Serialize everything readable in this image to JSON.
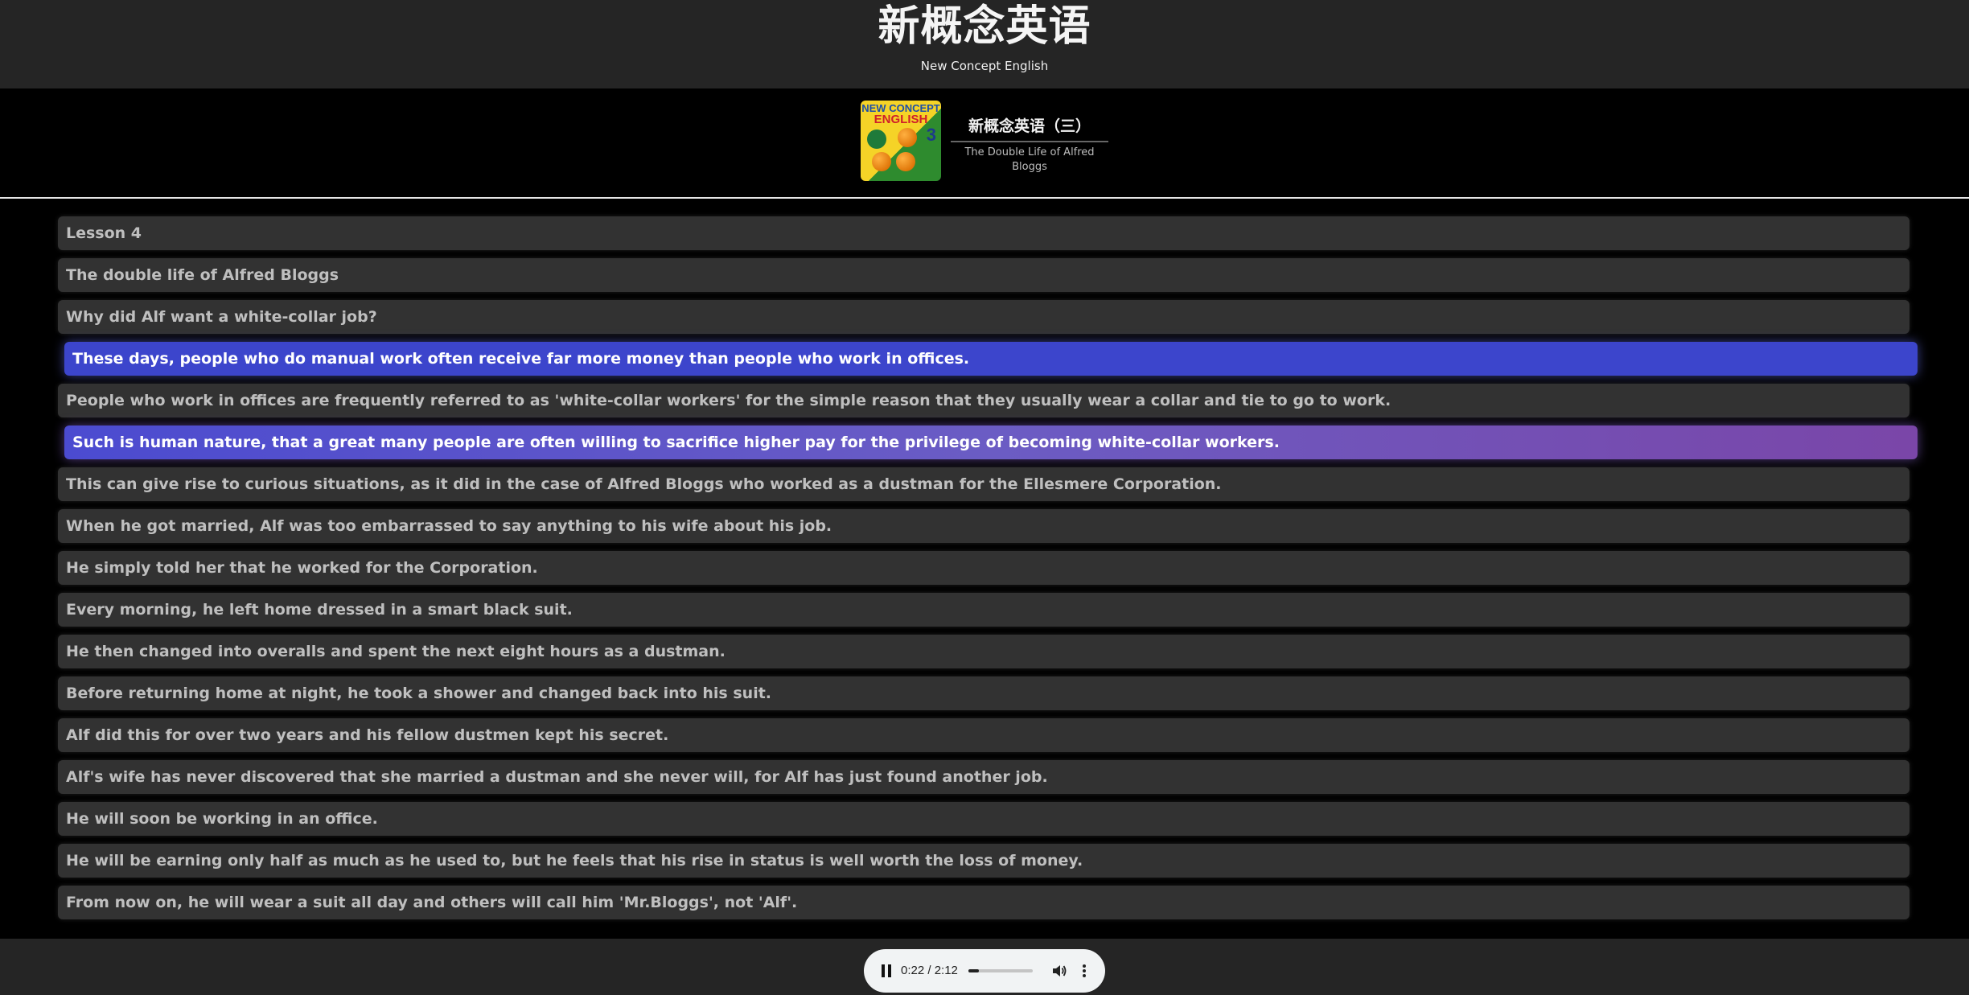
{
  "header": {
    "title": "新概念英语",
    "subtitle": "New Concept English"
  },
  "book": {
    "cover": {
      "line1": "NEW CONCEPT",
      "line2": "ENGLISH",
      "number": "3"
    },
    "name": "新概念英语（三）",
    "lesson_title": "The Double Life of Alfred Bloggs"
  },
  "sentences": [
    "Lesson 4",
    "The double life of Alfred Bloggs",
    "Why did Alf want a white-collar job?",
    "These days, people who do manual work often receive far more money than people who work in offices.",
    "People who work in offices are frequently referred to as 'white-collar workers' for the simple reason that they usually wear a collar and tie to go to work.",
    "Such is human nature, that a great many people are often willing to sacrifice higher pay for the privilege of becoming white-collar workers.",
    "This can give rise to curious situations, as it did in the case of Alfred Bloggs who worked as a dustman for the Ellesmere Corporation.",
    "When he got married, Alf was too embarrassed to say anything to his wife about his job.",
    "He simply told her that he worked for the Corporation.",
    "Every morning, he left home dressed in a smart black suit.",
    "He then changed into overalls and spent the next eight hours as a dustman.",
    "Before returning home at night, he took a shower and changed back into his suit.",
    "Alf did this for over two years and his fellow dustmen kept his secret.",
    "Alf's wife has never discovered that she married a dustman and she never will, for Alf has just found another job.",
    "He will soon be working in an office.",
    "He will be earning only half as much as he used to, but he feels that his rise in status is well worth the loss of money.",
    "From now on, he will wear a suit all day and others will call him 'Mr.Bloggs', not 'Alf'."
  ],
  "highlight": {
    "current_index": 3,
    "next_index": 5,
    "current_color": "#3c45cc",
    "next_color": "#6b5cc4"
  },
  "player": {
    "state_icon": "pause-icon",
    "time": "0:22 / 2:12",
    "progress": 0.167,
    "volume_icon": "volume-icon",
    "menu_icon": "more-vertical-icon"
  }
}
